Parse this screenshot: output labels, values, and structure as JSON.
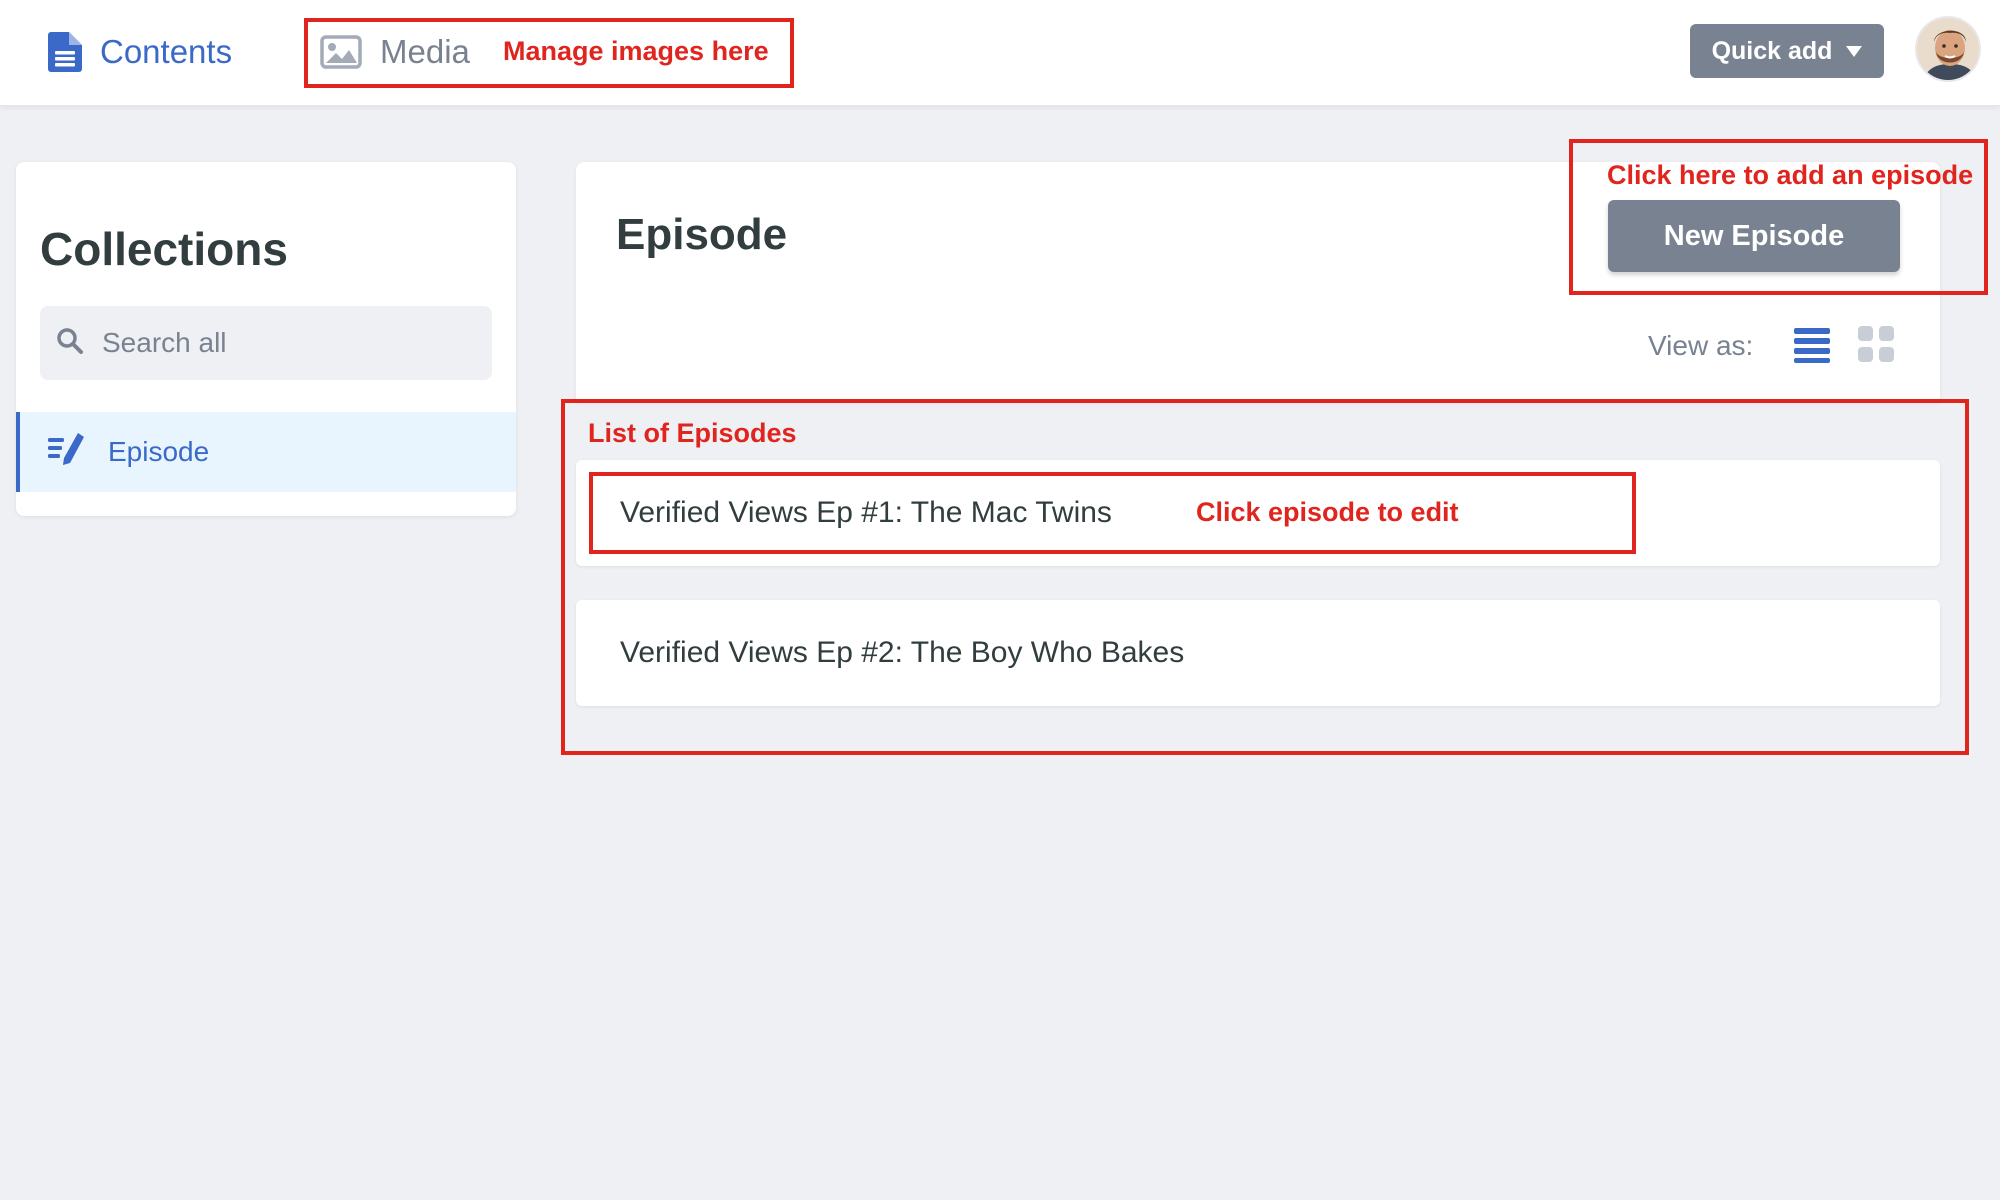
{
  "topbar": {
    "nav": [
      {
        "label": "Contents",
        "icon": "document-icon",
        "active": true
      },
      {
        "label": "Media",
        "icon": "image-icon",
        "active": false
      }
    ],
    "quick_add_label": "Quick add",
    "avatar_icon": "user-avatar"
  },
  "sidebar": {
    "title": "Collections",
    "search_placeholder": "Search all",
    "items": [
      {
        "label": "Episode",
        "icon": "edit-list-icon",
        "selected": true
      }
    ]
  },
  "main": {
    "title": "Episode",
    "new_button_label": "New Episode",
    "view_as_label": "View as:",
    "view_modes": [
      "list-view-icon",
      "grid-view-icon"
    ],
    "active_view": "list",
    "entries": [
      {
        "title": "Verified Views Ep #1: The Mac Twins"
      },
      {
        "title": "Verified Views Ep #2: The Boy Who Bakes"
      }
    ]
  },
  "annotations": {
    "media": "Manage images here",
    "new_episode": "Click here to add an episode",
    "list": "List of Episodes",
    "entry": "Click episode to edit"
  },
  "colors": {
    "accent": "#3a69c7",
    "button": "#798291",
    "annotation": "#e0251f",
    "background": "#eff0f4",
    "selected_bg": "#e8f5fe"
  }
}
